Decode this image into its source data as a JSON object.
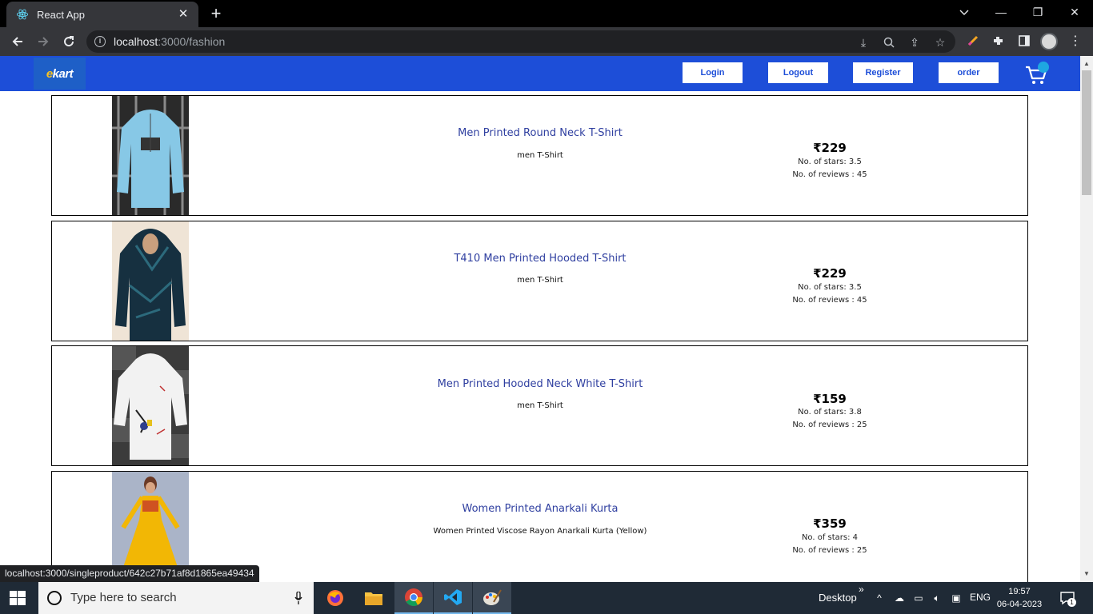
{
  "browser": {
    "tab_title": "React App",
    "new_tab": "+",
    "url_host": "localhost",
    "url_path": ":3000/fashion",
    "window_controls": {
      "minimize": "—",
      "restore": "❐",
      "close": "✕"
    }
  },
  "header": {
    "logo_e": "e",
    "logo_rest": "kart",
    "nav": {
      "login": "Login",
      "logout": "Logout",
      "register": "Register",
      "order": "order"
    },
    "colors": {
      "bar": "#1d4ed8",
      "badge": "#1ea7e1"
    }
  },
  "products": [
    {
      "title": "Men Printed Round Neck T-Shirt",
      "desc": "men T-Shirt",
      "price": "₹229",
      "stars": "No. of stars: 3.5",
      "reviews": "No. of reviews : 45",
      "image": "light-blue-sweatshirt"
    },
    {
      "title": "T410 Men Printed Hooded T-Shirt",
      "desc": "men T-Shirt",
      "price": "₹229",
      "stars": "No. of stars: 3.5",
      "reviews": "No. of reviews : 45",
      "image": "dark-teal-hoodie"
    },
    {
      "title": "Men Printed Hooded Neck White T-Shirt",
      "desc": "men T-Shirt",
      "price": "₹159",
      "stars": "No. of stars: 3.8",
      "reviews": "No. of reviews : 25",
      "image": "white-printed-hoodie"
    },
    {
      "title": "Women Printed Anarkali Kurta",
      "desc": "Women Printed Viscose Rayon Anarkali Kurta (Yellow)",
      "price": "₹359",
      "stars": "No. of stars: 4",
      "reviews": "No. of reviews : 25",
      "image": "yellow-anarkali-kurta"
    }
  ],
  "status_url": "localhost:3000/singleproduct/642c27b71af8d1865ea49434",
  "taskbar": {
    "search_placeholder": "Type here to search",
    "desktop_label": "Desktop",
    "chevrons": "»",
    "language": "ENG",
    "time": "19:57",
    "date": "06-04-2023",
    "notification_count": "1"
  }
}
